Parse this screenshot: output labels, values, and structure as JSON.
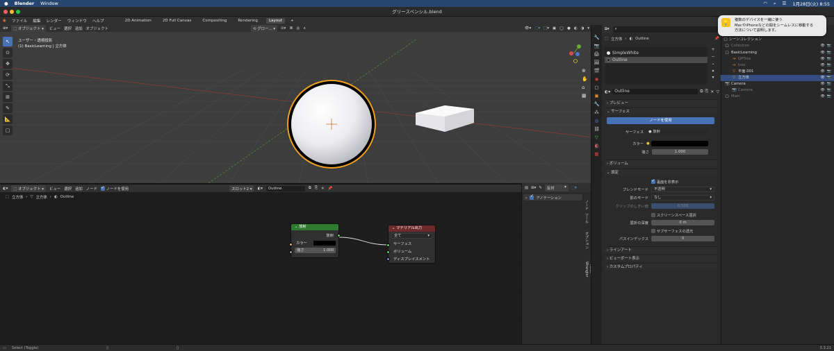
{
  "mac_menu": {
    "app": "Blender",
    "window": "Window",
    "datetime": "1月28日(火) 8:55"
  },
  "window_title": "グリースペンシル.blend",
  "menus": [
    "ファイル",
    "編集",
    "レンダー",
    "ウィンドウ",
    "ヘルプ"
  ],
  "workspaces": [
    "2D Animation",
    "2D Full Canvas",
    "Compositing",
    "Rendering",
    "Layout"
  ],
  "workspace_add": "+",
  "viewport": {
    "mode": "オブジェクト",
    "menus": [
      "ビュー",
      "選択",
      "追加",
      "オブジェクト"
    ],
    "transform": "グロー...",
    "view_name": "ユーザー・透視投影",
    "collection_info": "(1) BasicLearning | 立方体"
  },
  "node_editor": {
    "mode": "オブジェクト",
    "menus": [
      "ビュー",
      "選択",
      "追加",
      "ノード"
    ],
    "use_nodes_label": "ノードを使用",
    "slot": "スロット2",
    "material": "Outline",
    "breadcrumb": [
      "立方体",
      "立方体",
      "Outline"
    ],
    "emission_node": {
      "title": "放射",
      "out": "放射",
      "color_label": "カラー",
      "strength_label": "強さ",
      "strength": "1.000"
    },
    "output_node": {
      "title": "マテリアル出力",
      "target": "全て",
      "inputs": [
        "サーフェス",
        "ボリューム",
        "ディスプレイスメント"
      ]
    },
    "npanel": {
      "dropdown": "反対",
      "annotation_label": "アノテーション",
      "tabs": [
        "ノード",
        "ツール",
        "オプション",
        "Node Wrangler"
      ]
    }
  },
  "properties": {
    "breadcrumb": [
      "立方体",
      "Outline"
    ],
    "slots": [
      "SimpleWhite",
      "Outline"
    ],
    "material_name": "Outline",
    "sections": {
      "preview": "プレビュー",
      "surface": "サーフェス",
      "volume": "ボリューム",
      "settings": "設定",
      "lineart": "ラインアート",
      "viewport_display": "ビューポート表示",
      "custom_props": "カスタムプロパティ"
    },
    "use_nodes_btn": "ノードを使用",
    "surface_label": "サーフェス",
    "surface_value": "放射",
    "color_label": "カラー",
    "strength_label": "強さ",
    "strength_value": "1.000",
    "backface_label": "裏面を非表示",
    "blend_label": "ブレンドモード",
    "blend_value": "不透明",
    "shadow_label": "影のモード",
    "shadow_value": "なし",
    "clip_label": "クリップのしきい値",
    "clip_value": "0.500",
    "ssr_label": "スクリーンスペース屈折",
    "refr_label": "屈折の深度",
    "refr_value": "0 m",
    "sss_label": "サブサーフェスの透光",
    "pass_label": "パスインデックス",
    "pass_value": "0"
  },
  "outliner": {
    "scene_label": "シーンコレクション",
    "rows": [
      {
        "name": "Collection",
        "indent": 0,
        "dim": true
      },
      {
        "name": "BasicLearning",
        "indent": 0,
        "dim": false
      },
      {
        "name": "GPTree",
        "indent": 1,
        "dim": true
      },
      {
        "name": "tree",
        "indent": 1,
        "dim": true
      },
      {
        "name": "平面.001",
        "indent": 1,
        "dim": false
      },
      {
        "name": "立方体",
        "indent": 1,
        "dim": false,
        "selected": true
      },
      {
        "name": "Camera",
        "indent": 0,
        "dim": false
      },
      {
        "name": "Camera",
        "indent": 1,
        "dim": true
      },
      {
        "name": "Main",
        "indent": 0,
        "dim": true
      }
    ]
  },
  "notification": {
    "line1": "複数のデバイスを一緒に使う",
    "line2": "MacやiPhoneなどの間をシームレスに移動する",
    "line3": "方法について説明します。"
  },
  "status": {
    "select": "Select (Toggle)",
    "version": "3.3.21"
  },
  "colors": {
    "selection": "#4772b3",
    "orange": "#f0a020",
    "emission_header": "#2f7a2f",
    "output_header": "#6e2a2a"
  }
}
